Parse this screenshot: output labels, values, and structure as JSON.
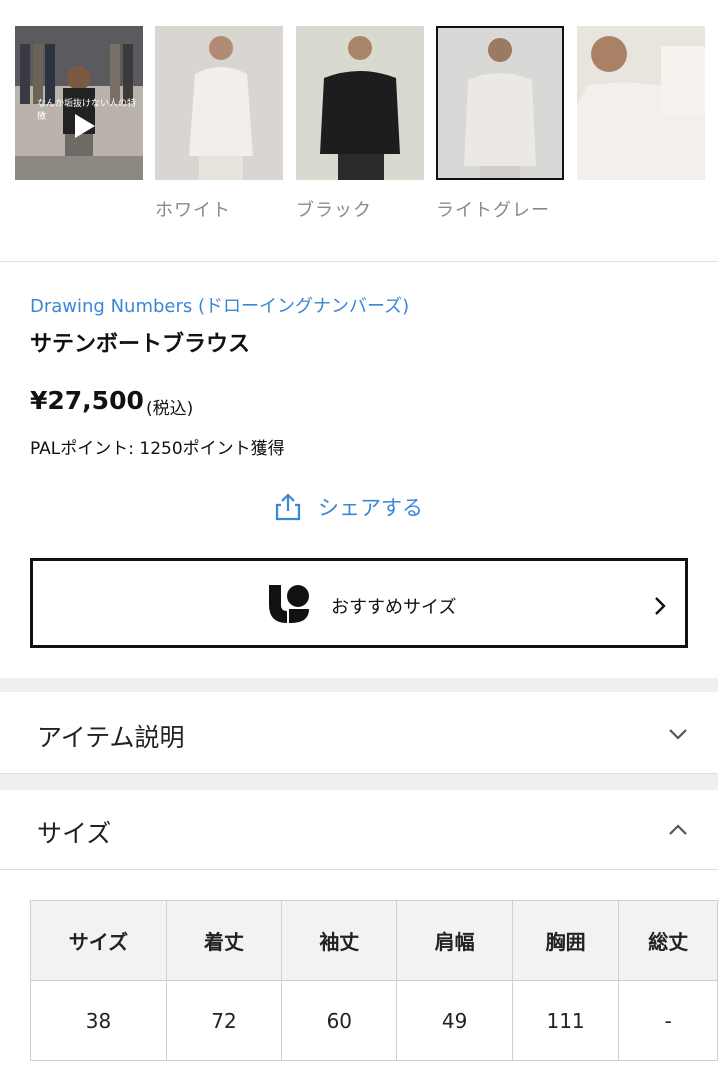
{
  "thumbnails": {
    "video_overlay_text": "なんか垢抜けない人の特徴",
    "captions": [
      "ホワイト",
      "ブラック",
      "ライトグレー"
    ]
  },
  "product": {
    "brand": "Drawing Numbers (ドローイングナンバーズ)",
    "title": "サテンボートブラウス",
    "price": "¥27,500",
    "tax_note": "(税込)",
    "points": "PALポイント: 1250ポイント獲得"
  },
  "share": {
    "label": "シェアする"
  },
  "recommend": {
    "label": "おすすめサイズ"
  },
  "accordion": {
    "description_label": "アイテム説明",
    "size_label": "サイズ"
  },
  "size_table": {
    "headers": [
      "サイズ",
      "着丈",
      "袖丈",
      "肩幅",
      "胸囲",
      "総丈"
    ],
    "rows": [
      [
        "38",
        "72",
        "60",
        "49",
        "111",
        "-"
      ]
    ]
  },
  "colors": {
    "link": "#3a87d6",
    "border": "#111111"
  }
}
